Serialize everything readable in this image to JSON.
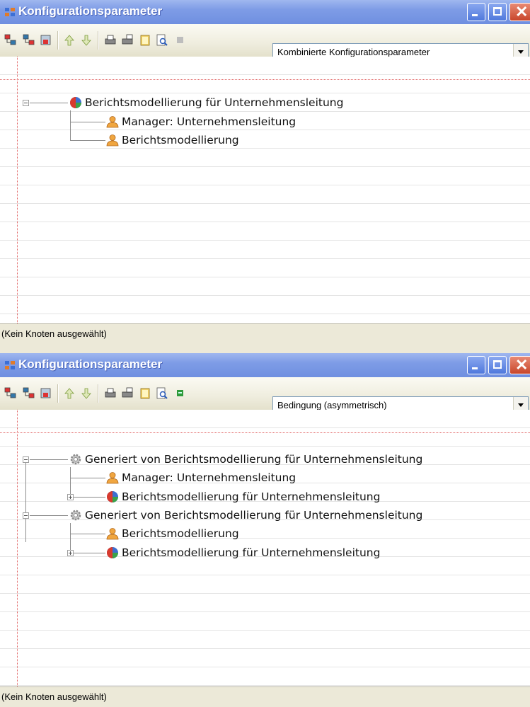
{
  "panels": [
    {
      "title": "Konfigurationsparameter",
      "combo_value": "Kombinierte Konfigurationsparameter",
      "status": "(Kein Knoten ausgewählt)",
      "tree": [
        {
          "label": "Berichtsmodellierung für Unternehmensleitung",
          "icon": "globe-icon",
          "expander": "minus"
        },
        {
          "label": "Manager: Unternehmensleitung",
          "icon": "user-icon"
        },
        {
          "label": "Berichtsmodellierung",
          "icon": "user-icon"
        }
      ]
    },
    {
      "title": "Konfigurationsparameter",
      "combo_value": "Bedingung (asymmetrisch)",
      "status": "(Kein Knoten ausgewählt)",
      "tree": [
        {
          "label": "Generiert von Berichtsmodellierung für Unternehmensleitung",
          "icon": "gear-icon",
          "expander": "minus"
        },
        {
          "label": "Manager: Unternehmensleitung",
          "icon": "user-icon"
        },
        {
          "label": "Berichtsmodellierung für Unternehmensleitung",
          "icon": "globe-icon",
          "expander": "plus"
        },
        {
          "label": "Generiert von Berichtsmodellierung für Unternehmensleitung",
          "icon": "gear-icon",
          "expander": "minus"
        },
        {
          "label": "Berichtsmodellierung",
          "icon": "user-icon"
        },
        {
          "label": "Berichtsmodellierung für Unternehmensleitung",
          "icon": "globe-icon",
          "expander": "plus"
        }
      ]
    }
  ],
  "toolbar_icons": [
    "add-node-icon",
    "add-child-icon",
    "add-item-icon",
    "move-up-icon",
    "move-down-icon",
    "print-icon",
    "print-preview-icon",
    "book-icon",
    "search-icon",
    "status-indicator-icon"
  ],
  "colors": {
    "title_gradient": "#7e9ce6",
    "close_button": "#c8462b",
    "margin_line": "#e06060"
  }
}
